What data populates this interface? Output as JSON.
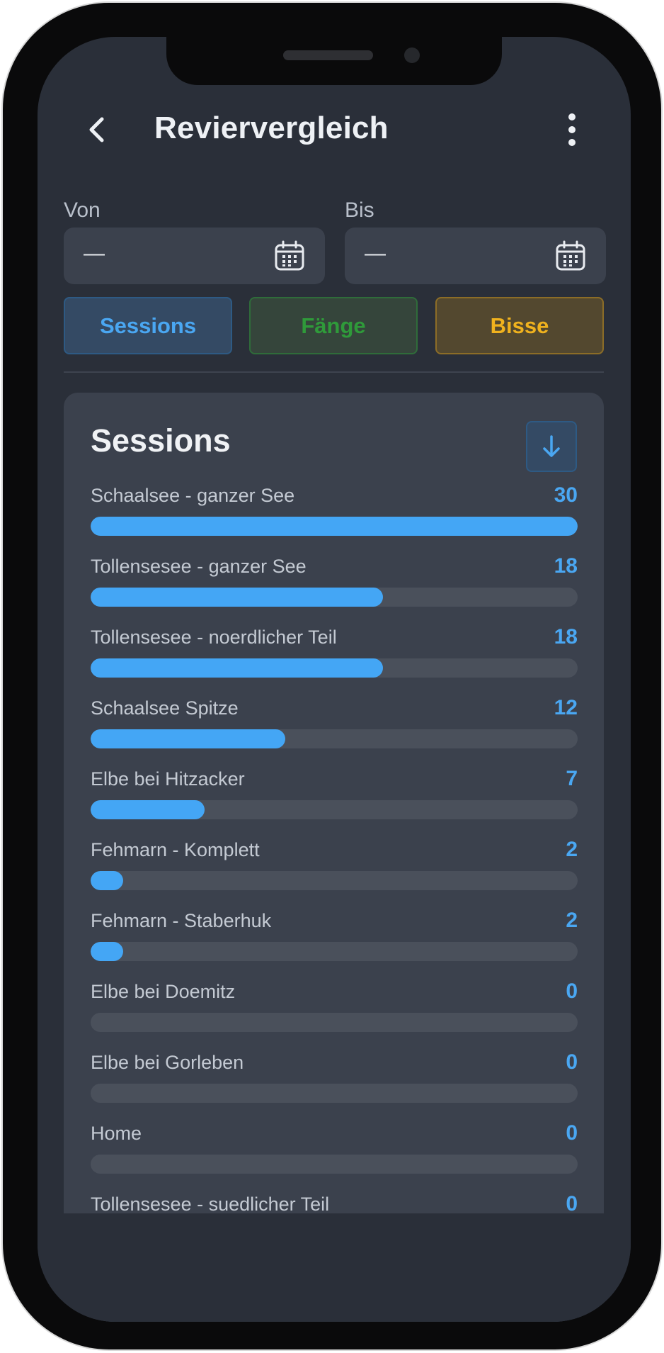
{
  "header": {
    "title": "Reviervergleich"
  },
  "dates": {
    "from_label": "Von",
    "from_value": "—",
    "to_label": "Bis",
    "to_value": "—"
  },
  "tabs": [
    {
      "label": "Sessions",
      "color": "#4aa7f2",
      "bg": "#344a64",
      "border": "#2e5a84",
      "active": true
    },
    {
      "label": "Fänge",
      "color": "#2f9a3a",
      "bg": "#35453b",
      "border": "#2f6c3a",
      "active": false
    },
    {
      "label": "Bisse",
      "color": "#f0b21e",
      "bg": "#53482f",
      "border": "#8c6d27",
      "active": false
    }
  ],
  "card": {
    "title": "Sessions",
    "sort_icon": "arrow-down-icon",
    "max_value": 30,
    "rows": [
      {
        "label": "Schaalsee - ganzer See",
        "value": 30
      },
      {
        "label": "Tollensesee - ganzer See",
        "value": 18
      },
      {
        "label": "Tollensesee - noerdlicher Teil",
        "value": 18
      },
      {
        "label": "Schaalsee Spitze",
        "value": 12
      },
      {
        "label": "Elbe bei Hitzacker",
        "value": 7
      },
      {
        "label": "Fehmarn - Komplett",
        "value": 2
      },
      {
        "label": "Fehmarn - Staberhuk",
        "value": 2
      },
      {
        "label": "Elbe bei Doemitz",
        "value": 0
      },
      {
        "label": "Elbe bei Gorleben",
        "value": 0
      },
      {
        "label": "Home",
        "value": 0
      },
      {
        "label": "Tollensesee - suedlicher Teil",
        "value": 0
      }
    ]
  },
  "colors": {
    "accent": "#44a6f5",
    "background": "#2a2f39",
    "card": "#3b414d",
    "track": "#4a505b"
  }
}
